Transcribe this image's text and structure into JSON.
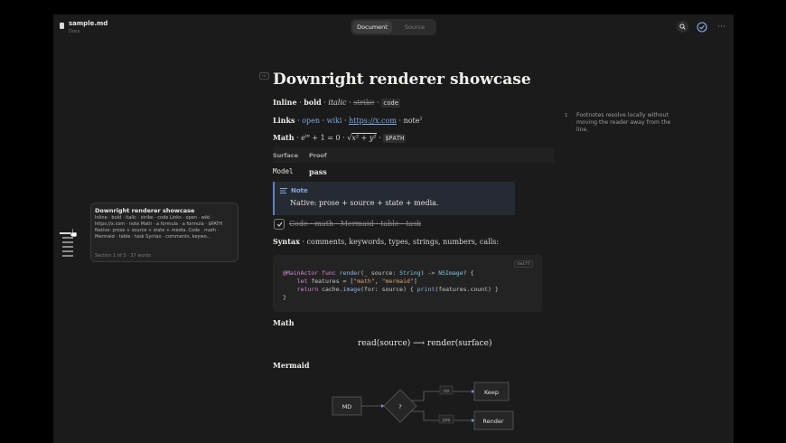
{
  "titlebar": {
    "file_name": "sample.md",
    "file_sub": "Docs",
    "tabs": [
      {
        "label": "Document",
        "active": true
      },
      {
        "label": "Source",
        "active": false
      }
    ],
    "more_label": "···"
  },
  "doc": {
    "heading": "Downright renderer showcase",
    "heading_tag": "H1",
    "inline": {
      "label": "Inline",
      "sep": " · ",
      "bold": "bold",
      "italic": "italic",
      "strike": "strike",
      "code": "code"
    },
    "links": {
      "label": "Links",
      "sep": " · ",
      "open": "open",
      "wiki": "wiki",
      "url": "https://x.com",
      "note": "note",
      "note_ref": "1"
    },
    "math": {
      "label": "Math",
      "sep": " · ",
      "euler_base": "e",
      "euler_exp": "iπ",
      "euler_rest": " + 1 = 0",
      "sqrt_sign": "√",
      "sqrt_body": "x² + y²",
      "path": "$PATH"
    },
    "table": {
      "headers": [
        "Surface",
        "Proof"
      ],
      "rows": [
        [
          "Model",
          "pass"
        ]
      ]
    },
    "callout": {
      "title": "Note",
      "body": "Native: prose + source + state + media."
    },
    "task": {
      "checked": true,
      "text": "Code · math · Mermaid · table · task"
    },
    "syntax": {
      "label": "Syntax",
      "text": " · comments, keywords, types, strings, numbers, calls:"
    },
    "code": {
      "lang": "swift",
      "lines": [
        "@MainActor func render(_ source: String) -> NSImage? {",
        "    let features = [\"math\", \"mermaid\"]",
        "    return cache.image(for: source) { print(features.count) }",
        "}"
      ]
    },
    "math_heading": "Math",
    "math_block": "read(source) ⟶ render(surface)",
    "mermaid_heading": "Mermaid",
    "mermaid": {
      "nodes": {
        "md": "MD",
        "decision": "?",
        "keep": "Keep",
        "render": "Render"
      },
      "edges": {
        "no": "no",
        "yes": "yes"
      }
    }
  },
  "footnote": {
    "number": "1",
    "text": "Footnotes resolve locally without moving the reader away from the line."
  },
  "tooltip": {
    "title": "Downright renderer showcase",
    "body": "Inline · bold · italic · strike · code Links · open · wiki · https://x.com · note Math · a formula · a formula · $PATH Native: prose + source + state + media. Code · math · Mermaid · table · task Syntax · comments, keywo...",
    "meta": "Section 1 of 5 · 37 words"
  },
  "colors": {
    "background": "#1b1b1b",
    "accent": "#7fa6e6",
    "callout_border": "#5d82c4"
  }
}
